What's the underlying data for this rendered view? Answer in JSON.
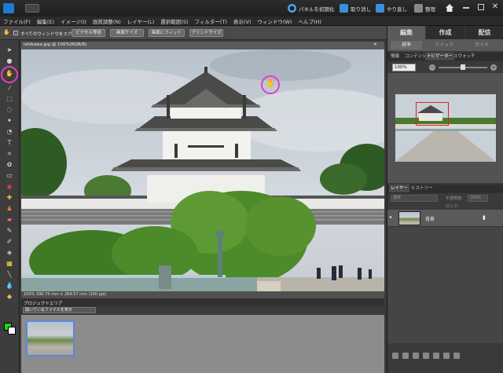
{
  "titlebar": {
    "reset_panels": "パネルを初期化",
    "undo": "取り消し",
    "redo": "やり直し",
    "organize": "整理"
  },
  "menu": [
    "ファイル(F)",
    "編集(E)",
    "イメージ(I)",
    "画質調整(N)",
    "レイヤー(L)",
    "選択範囲(S)",
    "フィルター(T)",
    "表示(V)",
    "ウィンドウ(W)",
    "ヘルプ(H)"
  ],
  "options": {
    "scroll_all": "すべてのウィンドウをスクロール",
    "actual_pixels": "ピクセル等倍",
    "fit_screen": "画面サイズ",
    "fill_screen": "画面にフィット",
    "print_size": "プリントサイズ"
  },
  "document": {
    "tab_label": "ishikawa.jpg @ 100%(RGB/8)",
    "status": "100%  396.75 mm × 264.57 mm (300 ppi)"
  },
  "project_bin": {
    "title": "プロジェクトエリア",
    "dropdown": "開いているファイルを表示"
  },
  "panel": {
    "tabs": [
      "編集",
      "作成",
      "配信"
    ],
    "subtabs": [
      "標準",
      "クイック",
      "ガイド"
    ],
    "nav_tabs": [
      "情報",
      "コンテンツ",
      "ナビゲーター",
      "スウォッチ"
    ],
    "zoom_value": "100%",
    "layer_tabs": [
      "レイヤー",
      "ヒストリー"
    ],
    "layer_mode": "通常",
    "opacity_label": "不透明度:",
    "opacity_value": "100%",
    "lock_label": "ロック:",
    "layer_name": "背景"
  },
  "colors": {
    "accent_annotation": "#e040c8",
    "foreground_color": "#18d818",
    "background_color": "#ffffff"
  }
}
